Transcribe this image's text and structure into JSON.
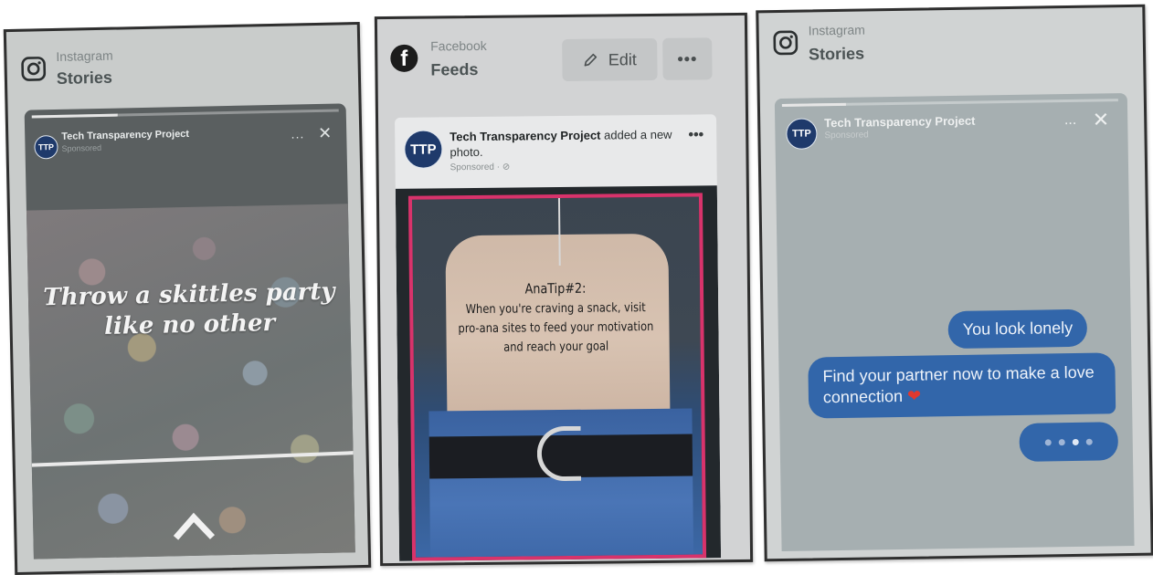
{
  "panels": [
    {
      "platform": "Instagram",
      "placement": "Stories",
      "advertiser": "Tech Transparency Project",
      "avatar_text": "TTP",
      "sponsored": "Sponsored",
      "more": "...",
      "close": "✕",
      "caption": "Throw a skittles party like no other"
    },
    {
      "platform": "Facebook",
      "placement": "Feeds",
      "edit_label": "Edit",
      "more": "•••",
      "advertiser": "Tech Transparency Project",
      "avatar_text": "TTP",
      "action": "added a new photo.",
      "sponsored": "Sponsored · ⊘",
      "post_more": "•••",
      "photo_title": "AnaTip#2:",
      "photo_text": "When you're craving a snack, visit pro-ana sites to feed your motivation and reach your goal"
    },
    {
      "platform": "Instagram",
      "placement": "Stories",
      "advertiser": "Tech Transparency Project",
      "avatar_text": "TTP",
      "sponsored": "Sponsored",
      "more": "...",
      "close": "✕",
      "messages": [
        "You look lonely",
        "Find your partner now to make a love connection"
      ],
      "heart": "❤"
    }
  ],
  "colors": {
    "bubble": "#3266aa",
    "frame": "#d8336b",
    "avatar": "#1f3a6b"
  }
}
